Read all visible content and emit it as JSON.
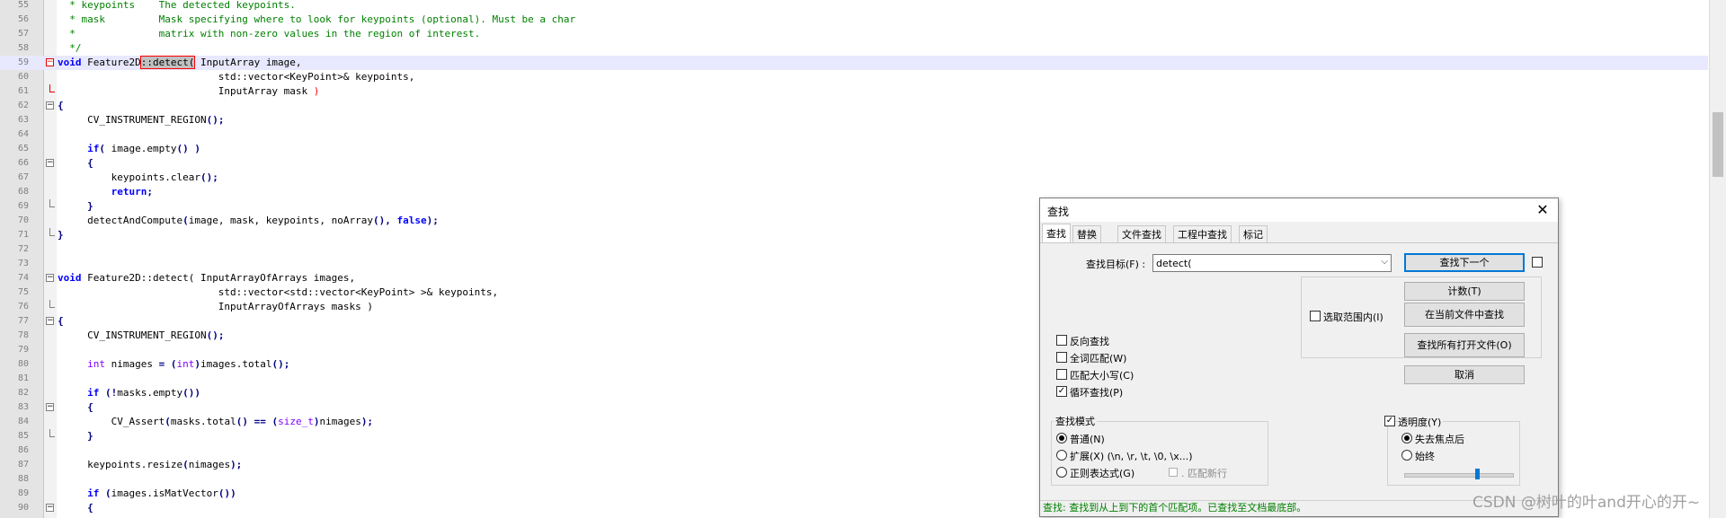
{
  "editor": {
    "lines": [
      {
        "n": "55",
        "fold": "",
        "spans": [
          {
            "c": "cm",
            "t": "  * keypoints    The detected keypoints."
          }
        ]
      },
      {
        "n": "56",
        "fold": "",
        "spans": [
          {
            "c": "cm",
            "t": "  * mask         Mask specifying where to look for keypoints (optional). Must be a char"
          }
        ]
      },
      {
        "n": "57",
        "fold": "",
        "spans": [
          {
            "c": "cm",
            "t": "  *              matrix with non-zero values in the region of interest."
          }
        ]
      },
      {
        "n": "58",
        "fold": "",
        "spans": [
          {
            "c": "cm",
            "t": "  */"
          }
        ]
      },
      {
        "n": "59",
        "fold": "minus-red",
        "current": true,
        "spans": [
          {
            "c": "kw",
            "t": "void"
          },
          {
            "c": "",
            "t": " Feature2D"
          },
          {
            "c": "hl",
            "t": "::detect("
          },
          {
            "c": "",
            "t": " InputArray image,"
          }
        ]
      },
      {
        "n": "60",
        "fold": "",
        "spans": [
          {
            "c": "",
            "t": "                           std::vector<KeyPoint>& keypoints,"
          }
        ]
      },
      {
        "n": "61",
        "fold": "end-red",
        "spans": [
          {
            "c": "",
            "t": "                           InputArray mask "
          },
          {
            "c": "rd",
            "t": ")"
          }
        ]
      },
      {
        "n": "62",
        "fold": "minus",
        "spans": [
          {
            "c": "op",
            "t": "{"
          }
        ]
      },
      {
        "n": "63",
        "fold": "",
        "spans": [
          {
            "c": "",
            "t": "     CV_INSTRUMENT_REGION"
          },
          {
            "c": "op",
            "t": "();"
          }
        ]
      },
      {
        "n": "64",
        "fold": "",
        "spans": []
      },
      {
        "n": "65",
        "fold": "",
        "spans": [
          {
            "c": "",
            "t": "     "
          },
          {
            "c": "kw",
            "t": "if"
          },
          {
            "c": "op",
            "t": "("
          },
          {
            "c": "",
            "t": " image.empty"
          },
          {
            "c": "op",
            "t": "()"
          },
          {
            "c": "",
            "t": " "
          },
          {
            "c": "op",
            "t": ")"
          }
        ]
      },
      {
        "n": "66",
        "fold": "minus",
        "spans": [
          {
            "c": "",
            "t": "     "
          },
          {
            "c": "op",
            "t": "{"
          }
        ]
      },
      {
        "n": "67",
        "fold": "",
        "spans": [
          {
            "c": "",
            "t": "         keypoints.clear"
          },
          {
            "c": "op",
            "t": "();"
          }
        ]
      },
      {
        "n": "68",
        "fold": "",
        "spans": [
          {
            "c": "",
            "t": "         "
          },
          {
            "c": "kw",
            "t": "return"
          },
          {
            "c": "op",
            "t": ";"
          }
        ]
      },
      {
        "n": "69",
        "fold": "end",
        "spans": [
          {
            "c": "",
            "t": "     "
          },
          {
            "c": "op",
            "t": "}"
          }
        ]
      },
      {
        "n": "70",
        "fold": "",
        "spans": [
          {
            "c": "",
            "t": "     detectAndCompute"
          },
          {
            "c": "op",
            "t": "("
          },
          {
            "c": "",
            "t": "image, mask, keypoints, noArray"
          },
          {
            "c": "op",
            "t": "(),"
          },
          {
            "c": "",
            "t": " "
          },
          {
            "c": "kw",
            "t": "false"
          },
          {
            "c": "op",
            "t": ");"
          }
        ]
      },
      {
        "n": "71",
        "fold": "end",
        "spans": [
          {
            "c": "op",
            "t": "}"
          }
        ]
      },
      {
        "n": "72",
        "fold": "",
        "spans": []
      },
      {
        "n": "73",
        "fold": "",
        "spans": []
      },
      {
        "n": "74",
        "fold": "minus",
        "spans": [
          {
            "c": "kw",
            "t": "void"
          },
          {
            "c": "",
            "t": " Feature2D::detect( InputArrayOfArrays images,"
          }
        ]
      },
      {
        "n": "75",
        "fold": "",
        "spans": [
          {
            "c": "",
            "t": "                           std::vector<std::vector<KeyPoint> >& keypoints,"
          }
        ]
      },
      {
        "n": "76",
        "fold": "end",
        "spans": [
          {
            "c": "",
            "t": "                           InputArrayOfArrays masks )"
          }
        ]
      },
      {
        "n": "77",
        "fold": "minus",
        "spans": [
          {
            "c": "op",
            "t": "{"
          }
        ]
      },
      {
        "n": "78",
        "fold": "",
        "spans": [
          {
            "c": "",
            "t": "     CV_INSTRUMENT_REGION"
          },
          {
            "c": "op",
            "t": "();"
          }
        ]
      },
      {
        "n": "79",
        "fold": "",
        "spans": []
      },
      {
        "n": "80",
        "fold": "",
        "spans": [
          {
            "c": "",
            "t": "     "
          },
          {
            "c": "ty",
            "t": "int"
          },
          {
            "c": "",
            "t": " nimages "
          },
          {
            "c": "op",
            "t": "="
          },
          {
            "c": "",
            "t": " "
          },
          {
            "c": "op",
            "t": "("
          },
          {
            "c": "ty",
            "t": "int"
          },
          {
            "c": "op",
            "t": ")"
          },
          {
            "c": "",
            "t": "images.total"
          },
          {
            "c": "op",
            "t": "();"
          }
        ]
      },
      {
        "n": "81",
        "fold": "",
        "spans": []
      },
      {
        "n": "82",
        "fold": "",
        "spans": [
          {
            "c": "",
            "t": "     "
          },
          {
            "c": "kw",
            "t": "if"
          },
          {
            "c": "",
            "t": " "
          },
          {
            "c": "op",
            "t": "(!"
          },
          {
            "c": "",
            "t": "masks.empty"
          },
          {
            "c": "op",
            "t": "())"
          }
        ]
      },
      {
        "n": "83",
        "fold": "minus",
        "spans": [
          {
            "c": "",
            "t": "     "
          },
          {
            "c": "op",
            "t": "{"
          }
        ]
      },
      {
        "n": "84",
        "fold": "",
        "spans": [
          {
            "c": "",
            "t": "         CV_Assert"
          },
          {
            "c": "op",
            "t": "("
          },
          {
            "c": "",
            "t": "masks.total"
          },
          {
            "c": "op",
            "t": "()"
          },
          {
            "c": "",
            "t": " "
          },
          {
            "c": "op",
            "t": "=="
          },
          {
            "c": "",
            "t": " "
          },
          {
            "c": "op",
            "t": "("
          },
          {
            "c": "ty",
            "t": "size_t"
          },
          {
            "c": "op",
            "t": ")"
          },
          {
            "c": "",
            "t": "nimages"
          },
          {
            "c": "op",
            "t": ");"
          }
        ]
      },
      {
        "n": "85",
        "fold": "end",
        "spans": [
          {
            "c": "",
            "t": "     "
          },
          {
            "c": "op",
            "t": "}"
          }
        ]
      },
      {
        "n": "86",
        "fold": "",
        "spans": []
      },
      {
        "n": "87",
        "fold": "",
        "spans": [
          {
            "c": "",
            "t": "     keypoints.resize"
          },
          {
            "c": "op",
            "t": "("
          },
          {
            "c": "",
            "t": "nimages"
          },
          {
            "c": "op",
            "t": ");"
          }
        ]
      },
      {
        "n": "88",
        "fold": "",
        "spans": []
      },
      {
        "n": "89",
        "fold": "",
        "spans": [
          {
            "c": "",
            "t": "     "
          },
          {
            "c": "kw",
            "t": "if"
          },
          {
            "c": "",
            "t": " "
          },
          {
            "c": "op",
            "t": "("
          },
          {
            "c": "",
            "t": "images.isMatVector"
          },
          {
            "c": "op",
            "t": "())"
          }
        ]
      },
      {
        "n": "90",
        "fold": "minus",
        "spans": [
          {
            "c": "",
            "t": "     "
          },
          {
            "c": "op",
            "t": "{"
          }
        ]
      }
    ]
  },
  "dialog": {
    "title": "查找",
    "close_glyph": "✕",
    "tabs": [
      "查找",
      "替换",
      "文件查找",
      "工程中查找",
      "标记"
    ],
    "find_label": "查找目标(F) :",
    "find_value": "detect(",
    "buttons": {
      "find_next": "查找下一个",
      "count": "计数(T)",
      "find_in_current": "在当前文件中查找",
      "find_in_all": "查找所有打开文件(O)",
      "cancel": "取消"
    },
    "in_selection": "选取范围内(I)",
    "options": [
      {
        "label": "反向查找",
        "checked": false
      },
      {
        "label": "全词匹配(W)",
        "checked": false
      },
      {
        "label": "匹配大小写(C)",
        "checked": false
      },
      {
        "label": "循环查找(P)",
        "checked": true
      }
    ],
    "search_mode": {
      "title": "查找模式",
      "normal": "普通(N)",
      "extended": "扩展(X) (\\n, \\r, \\t, \\0, \\x...)",
      "regex": "正则表达式(G)",
      "match_newline": ". 匹配新行",
      "selected": "normal"
    },
    "transparency": {
      "title": "透明度(Y)",
      "checked": true,
      "on_lose_focus": "失去焦点后",
      "always": "始终",
      "selected": "on_lose_focus",
      "level": 0.6
    },
    "status": "查找: 查找到从上到下的首个匹配项。已查找至文档最底部。"
  },
  "watermark": "CSDN @树叶的叶and开心的开~"
}
